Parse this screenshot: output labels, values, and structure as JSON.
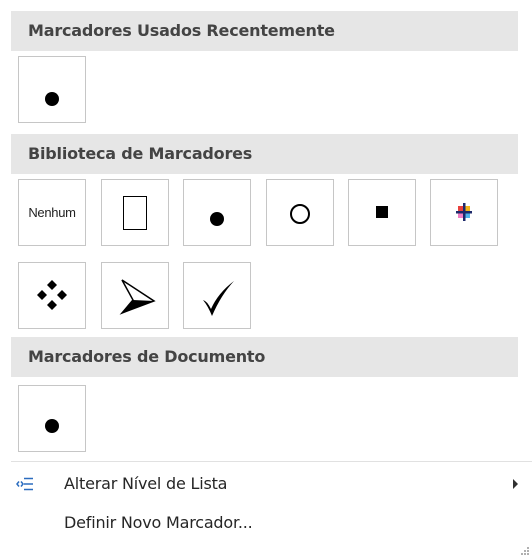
{
  "sections": {
    "recent": {
      "title": "Marcadores Usados Recentemente"
    },
    "library": {
      "title": "Biblioteca de Marcadores"
    },
    "document": {
      "title": "Marcadores de Documento"
    }
  },
  "library_tiles": {
    "none_label": "Nenhum"
  },
  "bullets": {
    "recent": [
      "filled-circle"
    ],
    "library": [
      "none",
      "hollow-square",
      "filled-circle",
      "hollow-circle",
      "filled-square",
      "multicolor-star",
      "four-diamonds",
      "arrowhead",
      "checkmark"
    ],
    "document": [
      "filled-circle"
    ]
  },
  "menu": {
    "change_level": {
      "label": "Alterar Nível de Lista",
      "icon": "list-indent-icon"
    },
    "define_new": {
      "label": "Definir Novo Marcador..."
    }
  },
  "colors": {
    "header_bg": "#e6e6e6",
    "tile_border": "#c6c6c6",
    "icon_blue": "#2b6cbf"
  }
}
